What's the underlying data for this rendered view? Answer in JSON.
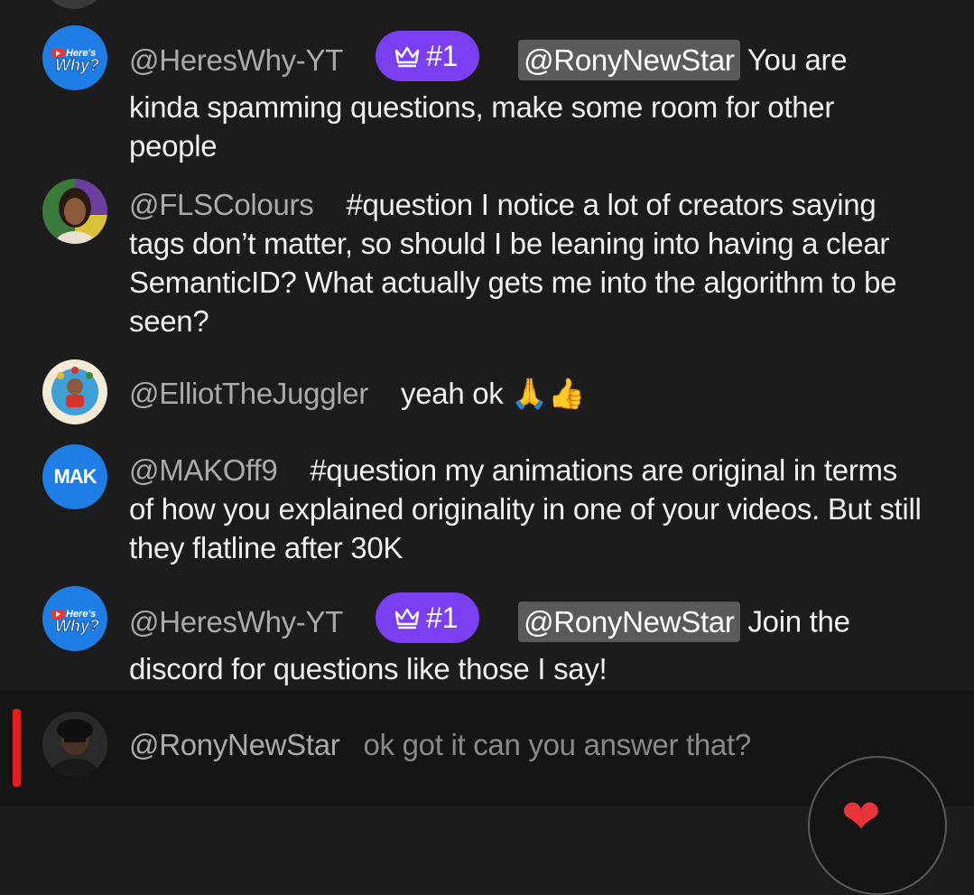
{
  "messages": [
    {
      "author": "@HeresWhy-YT",
      "badge": "#1",
      "mention": "@RonyNewStar",
      "text": " You are kinda spamming questions, make some room for other people"
    },
    {
      "author": "@FLSColours",
      "text": "#question I notice a lot of creators saying tags don’t matter, so should I be leaning into having a clear SemanticID? What actually gets me into the algorithm to be seen?"
    },
    {
      "author": "@ElliotTheJuggler",
      "text": "yeah ok 🙏👍"
    },
    {
      "author": "@MAKOff9",
      "avatar_text": "MAK",
      "text": "#question my animations are original in terms of how you explained originality in one of your videos. But still they flatline after 30K"
    },
    {
      "author": "@HeresWhy-YT",
      "badge": "#1",
      "mention": "@RonyNewStar",
      "text": " Join the discord for questions like those I say!"
    }
  ],
  "input": {
    "author": "@RonyNewStar",
    "placeholder": "ok got it can you answer that?"
  },
  "colors": {
    "background": "#1c1c1c",
    "badge": "#7b3ff2",
    "accent_red": "#e01e1e",
    "avatar_blue": "#1e7ee6"
  }
}
